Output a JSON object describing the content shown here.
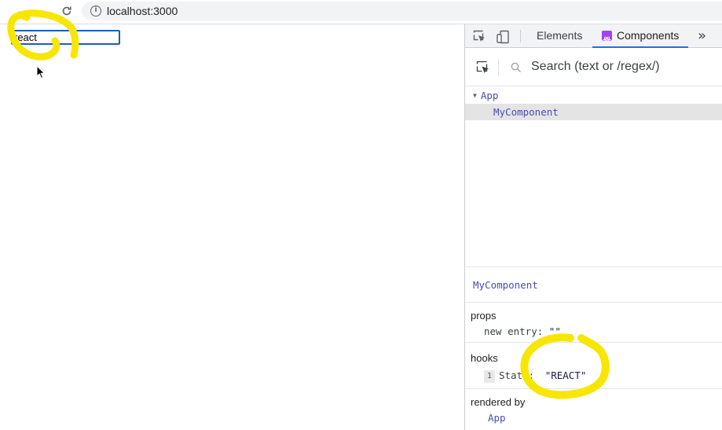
{
  "browser": {
    "back_icon": "arrow-left-icon",
    "forward_icon": "arrow-right-icon",
    "reload_icon": "reload-icon",
    "url": "localhost:3000"
  },
  "page": {
    "input_value": "react"
  },
  "devtools": {
    "tabs": [
      {
        "label": "Elements",
        "active": false
      },
      {
        "label": "Components",
        "active": true
      }
    ],
    "search": {
      "placeholder": "Search (text or /regex/)"
    },
    "tree": [
      {
        "label": "App",
        "expanded": true,
        "selected": false
      },
      {
        "label": "MyComponent",
        "selected": true
      }
    ],
    "selected_component": "MyComponent",
    "props": {
      "title": "props",
      "items": [
        {
          "key": "new entry:",
          "value": "\"\""
        }
      ]
    },
    "hooks": {
      "title": "hooks",
      "items": [
        {
          "index": "1",
          "key": "State:",
          "value": "\"REACT\""
        }
      ]
    },
    "rendered_by": {
      "title": "rendered by",
      "items": [
        "App"
      ]
    }
  },
  "colors": {
    "highlight": "#f7e600",
    "accent": "#1a73e8",
    "component_name": "#4c4cb8"
  }
}
